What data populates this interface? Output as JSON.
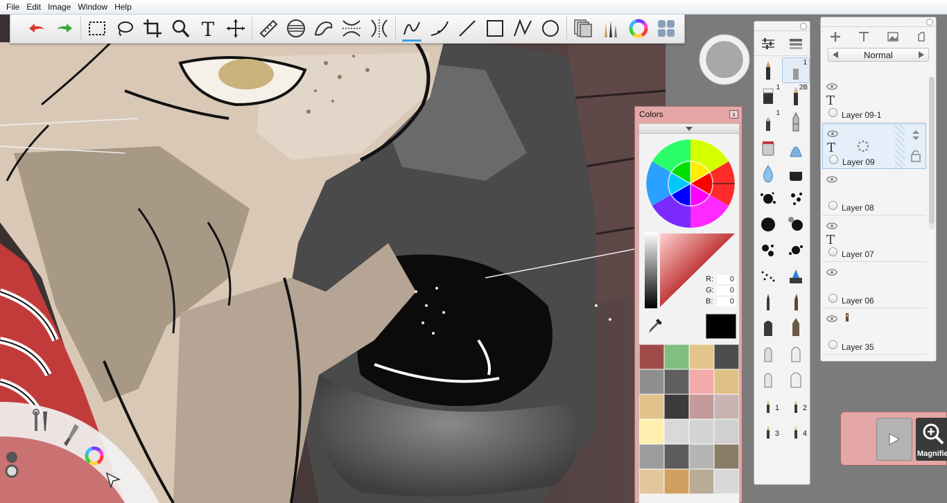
{
  "menu": {
    "items": [
      "File",
      "Edit",
      "Image",
      "Window",
      "Help"
    ]
  },
  "toolbar": {
    "tools": [
      {
        "name": "undo-icon"
      },
      {
        "name": "redo-icon"
      },
      {
        "name": "rect-select-icon"
      },
      {
        "name": "lasso-icon"
      },
      {
        "name": "crop-icon"
      },
      {
        "name": "zoom-icon"
      },
      {
        "name": "text-icon",
        "glyph": "T"
      },
      {
        "name": "move-icon"
      },
      {
        "name": "ruler-icon"
      },
      {
        "name": "ellipse-guide-icon"
      },
      {
        "name": "french-curve-icon"
      },
      {
        "name": "symmetry-x-icon"
      },
      {
        "name": "symmetry-y-icon"
      },
      {
        "name": "stroke-icon"
      },
      {
        "name": "curve-icon"
      },
      {
        "name": "line-icon"
      },
      {
        "name": "rectangle-icon"
      },
      {
        "name": "polyline-icon"
      },
      {
        "name": "circle-icon"
      },
      {
        "name": "layers-icon"
      },
      {
        "name": "brushes-icon"
      },
      {
        "name": "color-wheel-icon"
      },
      {
        "name": "palette-icon"
      }
    ]
  },
  "colors_panel": {
    "title": "Colors",
    "close": "x",
    "rgb": {
      "r_label": "R:",
      "g_label": "G:",
      "b_label": "B:",
      "r": "0",
      "g": "0",
      "b": "0"
    },
    "current_color": "#000000",
    "swatches": [
      "#a04a4a",
      "#7fbf7f",
      "#e3c48a",
      "#4d4d4d",
      "#8f8f8f",
      "#5f5f5f",
      "#f4aaaa",
      "#e0c085",
      "#e1c28b",
      "#3b3b3b",
      "#c49a9a",
      "#c9b3b3",
      "#fff0b0",
      "#d9d9d9",
      "#d4d4d4",
      "#d0d0d0",
      "#9c9c9c",
      "#5c5c5c",
      "#b5b5b5",
      "#8a7c66",
      "#e4c69e",
      "#d0a060",
      "#b8ac97",
      "#d8d8d8"
    ]
  },
  "brush_palette": {
    "numbers": {
      "pencil": "1",
      "pencil2b": "2B",
      "eraser": "1",
      "airbrush": "1",
      "b2": "2",
      "b3": "3",
      "b4": "4",
      "b1": "1"
    }
  },
  "layers_panel": {
    "blend_mode": "Normal",
    "layers": [
      {
        "name": "Layer 09-1",
        "type": "text",
        "glyph": "T"
      },
      {
        "name": "Layer 09",
        "type": "text",
        "glyph": "T",
        "selected": true
      },
      {
        "name": "Layer 08",
        "type": "paint"
      },
      {
        "name": "Layer 07",
        "type": "text",
        "glyph": "T"
      },
      {
        "name": "Layer 06",
        "type": "paint"
      },
      {
        "name": "Layer 35",
        "type": "paint"
      }
    ]
  },
  "magnifier": {
    "label": "Magnifier"
  },
  "accent": {
    "panel_pink": "#e4a6a6",
    "selection_blue": "#3aa0e8"
  }
}
